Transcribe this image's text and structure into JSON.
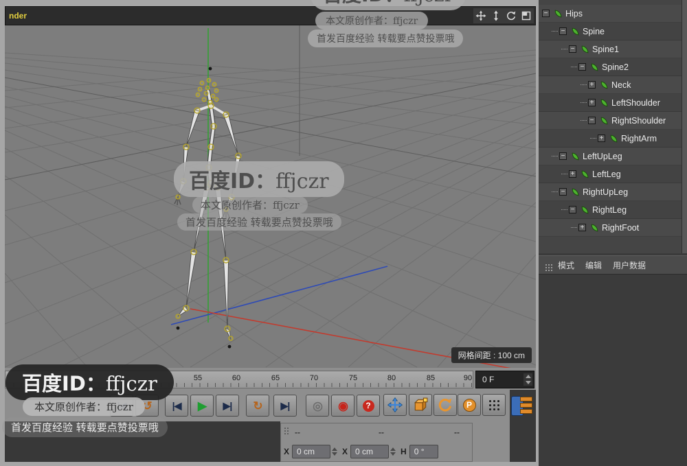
{
  "window": {
    "title_partial": "nder"
  },
  "viewport": {
    "grid_label": "网格间距 : 100 cm"
  },
  "watermark": {
    "id_label": "百度ID：",
    "id_value": "ffjczr",
    "author": "本文原创作者：ffjczr",
    "tip": "首发百度经验 转载要点赞投票哦"
  },
  "object_tree": {
    "items": [
      {
        "label": "Hips",
        "toggle": "−",
        "depth": 0
      },
      {
        "label": "Spine",
        "toggle": "−",
        "depth": 1
      },
      {
        "label": "Spine1",
        "toggle": "−",
        "depth": 2
      },
      {
        "label": "Spine2",
        "toggle": "−",
        "depth": 3
      },
      {
        "label": "Neck",
        "toggle": "+",
        "depth": 4
      },
      {
        "label": "LeftShoulder",
        "toggle": "+",
        "depth": 4
      },
      {
        "label": "RightShoulder",
        "toggle": "−",
        "depth": 4
      },
      {
        "label": "RightArm",
        "toggle": "+",
        "depth": 5
      },
      {
        "label": "LeftUpLeg",
        "toggle": "−",
        "depth": 1
      },
      {
        "label": "LeftLeg",
        "toggle": "+",
        "depth": 2
      },
      {
        "label": "RightUpLeg",
        "toggle": "−",
        "depth": 1
      },
      {
        "label": "RightLeg",
        "toggle": "−",
        "depth": 2
      },
      {
        "label": "RightFoot",
        "toggle": "+",
        "depth": 3
      }
    ]
  },
  "mode_bar": {
    "items": [
      "模式",
      "编辑",
      "用户数据"
    ]
  },
  "timeline": {
    "numbers": [
      "55",
      "60",
      "65",
      "70",
      "75",
      "80",
      "85",
      "90"
    ],
    "frame_field": "0 F"
  },
  "transport": {
    "goto_start": "|◀",
    "play_back": "↺",
    "prev_key": "|◀",
    "play": "▶",
    "next_key": "▶|",
    "loop": "↻",
    "goto_end": "▶|",
    "record_dim": "◎",
    "record": "◉",
    "help": "?"
  },
  "tools": {
    "p_label": "P"
  },
  "coords": {
    "dashes": [
      "--",
      "--",
      "--"
    ],
    "fields": [
      {
        "label": "X",
        "value": "0 cm"
      },
      {
        "label": "X",
        "value": "0 cm"
      },
      {
        "label": "H",
        "value": "0 °"
      }
    ]
  }
}
